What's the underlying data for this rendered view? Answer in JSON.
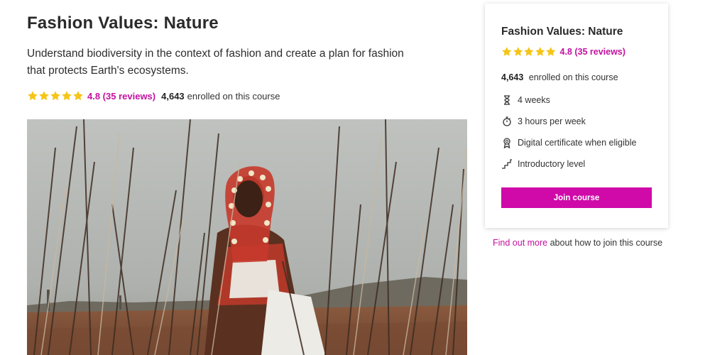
{
  "course": {
    "title": "Fashion Values: Nature",
    "description": "Understand biodiversity in the context of fashion and create a plan for fashion that protects Earth's ecosystems.",
    "rating_text": "4.8 (35 reviews)",
    "rating_value": 4.8,
    "stars_filled": 5,
    "enrolled_count": "4,643",
    "enrolled_suffix": "enrolled on this course"
  },
  "hero_image": {
    "icon": "photo-person-in-grass"
  },
  "card": {
    "title": "Fashion Values: Nature",
    "rating_text": "4.8 (35 reviews)",
    "enrolled_count": "4,643",
    "enrolled_suffix": "enrolled on this course",
    "features": [
      {
        "icon": "hourglass-icon",
        "label": "4 weeks"
      },
      {
        "icon": "stopwatch-icon",
        "label": "3 hours per week"
      },
      {
        "icon": "certificate-icon",
        "label": "Digital certificate when eligible"
      },
      {
        "icon": "steps-icon",
        "label": "Introductory level"
      }
    ],
    "join_label": "Join course"
  },
  "footer": {
    "link_text": "Find out more",
    "rest_text": "about how to join this course"
  },
  "colors": {
    "accent": "#cf0aa8",
    "link": "#c4119f",
    "star": "#f5c518"
  }
}
